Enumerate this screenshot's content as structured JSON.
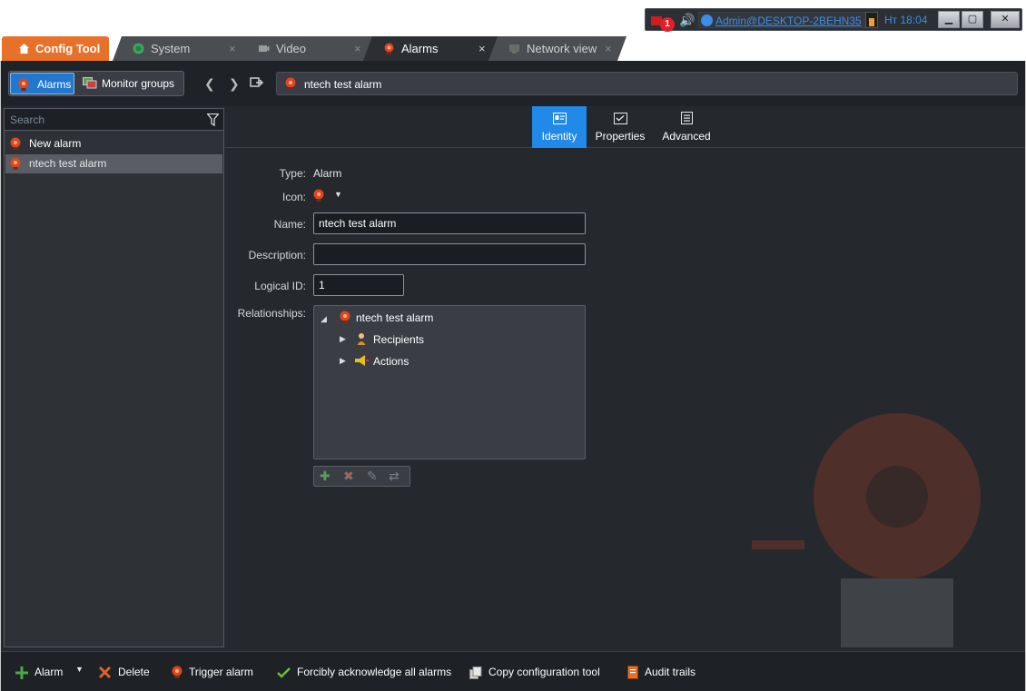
{
  "tray": {
    "alarm_count": "1",
    "user": "Admin@DESKTOP-2BEHN35",
    "clock": "Нт 18:04"
  },
  "tabs": [
    {
      "label": "Config Tool"
    },
    {
      "label": "System"
    },
    {
      "label": "Video"
    },
    {
      "label": "Alarms"
    },
    {
      "label": "Network view"
    }
  ],
  "toolbar": {
    "seg_alarms": "Alarms",
    "seg_monitor": "Monitor groups",
    "breadcrumb": "ntech test alarm"
  },
  "left": {
    "search_placeholder": "Search",
    "items": [
      {
        "label": "New alarm"
      },
      {
        "label": "ntech test alarm"
      }
    ]
  },
  "page_tabs": [
    {
      "label": "Identity"
    },
    {
      "label": "Properties"
    },
    {
      "label": "Advanced"
    }
  ],
  "form": {
    "type_label": "Type:",
    "type_value": "Alarm",
    "icon_label": "Icon:",
    "name_label": "Name:",
    "name_value": "ntech test alarm",
    "desc_label": "Description:",
    "desc_value": "",
    "logical_label": "Logical ID:",
    "logical_value": "1",
    "rel_label": "Relationships:",
    "tree": {
      "root": "ntech test alarm",
      "children": [
        "Recipients",
        "Actions"
      ]
    }
  },
  "bottom": {
    "alarm": "Alarm",
    "delete": "Delete",
    "trigger": "Trigger alarm",
    "ack": "Forcibly acknowledge all alarms",
    "copy": "Copy configuration tool",
    "audit": "Audit trails"
  },
  "colors": {
    "accent_orange": "#e8712a",
    "accent_blue": "#2189e8",
    "alarm_red": "#d9401e"
  }
}
